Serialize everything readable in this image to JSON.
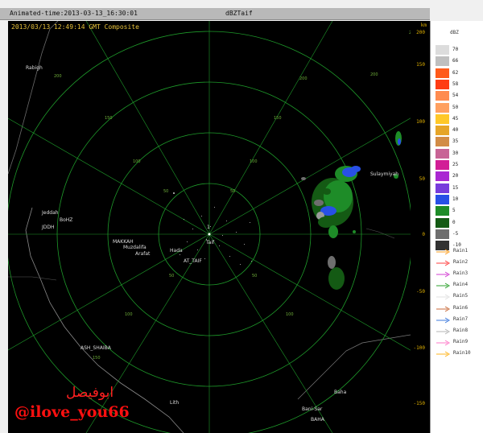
{
  "window": {
    "animated_time": "Animated-time:2013-03-13_16:30:01",
    "product": "dBZTaif"
  },
  "radar": {
    "header": "2013/03/13 12:49:14 GMT Composite",
    "station": "Taif",
    "range_km": 200,
    "ring_labels": [
      "50",
      "100",
      "150",
      "200"
    ],
    "places": [
      "Rabigh",
      "Jeddah",
      "BoHZ",
      "JDDH",
      "MAKKAH",
      "Muzdalifa",
      "Arafat",
      "Hada",
      "AT_TAIF",
      "Taif",
      "Sulaymiyah",
      "ASH_SHAIBA",
      "Lith",
      "Baha",
      "Bani-Sar",
      "BAHA"
    ]
  },
  "y_axis": {
    "unit": "km",
    "ticks": [
      "200",
      "150",
      "100",
      "50",
      "0",
      "-50",
      "-100",
      "-150"
    ]
  },
  "legend": {
    "title": "dBZ",
    "levels": [
      {
        "label": "70",
        "color": "#dcdcdc"
      },
      {
        "label": "66",
        "color": "#bfbfbf"
      },
      {
        "label": "62",
        "color": "#ff5a1a"
      },
      {
        "label": "58",
        "color": "#ff3c14"
      },
      {
        "label": "54",
        "color": "#ff8c50"
      },
      {
        "label": "50",
        "color": "#ffa060"
      },
      {
        "label": "45",
        "color": "#ffc828"
      },
      {
        "label": "40",
        "color": "#e6a528"
      },
      {
        "label": "35",
        "color": "#d28c46"
      },
      {
        "label": "30",
        "color": "#c86496"
      },
      {
        "label": "25",
        "color": "#d21e96"
      },
      {
        "label": "20",
        "color": "#aa28d2"
      },
      {
        "label": "15",
        "color": "#783cdc"
      },
      {
        "label": "10",
        "color": "#2850e6"
      },
      {
        "label": "5",
        "color": "#1e8c28"
      },
      {
        "label": "0",
        "color": "#145a14"
      },
      {
        "label": "-5",
        "color": "#6e6e6e"
      },
      {
        "label": "-10",
        "color": "#323232"
      }
    ],
    "tracks": [
      {
        "label": "Rain1",
        "color": "#ff9e1e"
      },
      {
        "label": "Rain2",
        "color": "#ff3c3c"
      },
      {
        "label": "Rain3",
        "color": "#d23cd2"
      },
      {
        "label": "Rain4",
        "color": "#2ca02c"
      },
      {
        "label": "Rain5",
        "color": "#e0e0e0"
      },
      {
        "label": "Rain6",
        "color": "#c86a3a"
      },
      {
        "label": "Rain7",
        "color": "#3c78dc"
      },
      {
        "label": "Rain8",
        "color": "#b4b4b4"
      },
      {
        "label": "Rain9",
        "color": "#ff78c8"
      },
      {
        "label": "Rain10",
        "color": "#ffb41e"
      }
    ]
  },
  "watermark": {
    "arabic": "ابوفيصل",
    "handle": "@ilove_you66"
  }
}
